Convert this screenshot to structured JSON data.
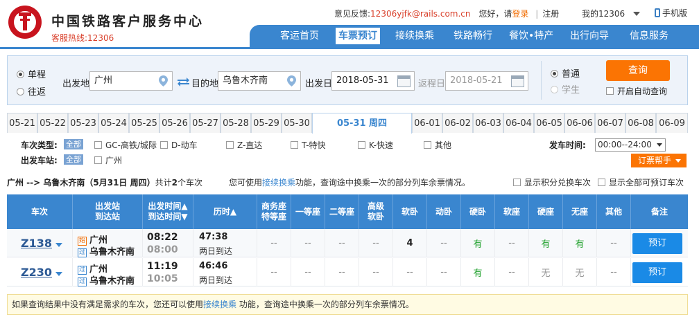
{
  "header": {
    "site_title": "中国铁路客户服务中心",
    "hotline": "客服热线:12306",
    "feedback_label": "意见反馈:",
    "feedback_email": "12306yjfk@rails.com.cn",
    "greeting": "您好，请",
    "login": "登录",
    "divider": "|",
    "register": "注册",
    "my_account": "我的12306",
    "mobile": "手机版"
  },
  "nav": {
    "items": [
      "客运首页",
      "车票预订",
      "接续换乘",
      "铁路畅行",
      "餐饮•特产",
      "出行向导",
      "信息服务"
    ],
    "active": "车票预订"
  },
  "search": {
    "trip_one_way": "单程",
    "trip_round": "往返",
    "from_label": "出发地",
    "from_value": "广州",
    "to_label": "目的地",
    "to_value": "乌鲁木齐南",
    "depart_label": "出发日",
    "depart_value": "2018-05-31",
    "return_label": "返程日",
    "return_value": "2018-05-21",
    "ticket_normal": "普通",
    "ticket_student": "学生",
    "query_button": "查询",
    "auto_query": "开启自动查询"
  },
  "dates": [
    "05-21",
    "05-22",
    "05-23",
    "05-24",
    "05-25",
    "05-26",
    "05-27",
    "05-28",
    "05-29",
    "05-30",
    "05-31 周四",
    "06-01",
    "06-02",
    "06-03",
    "06-04",
    "06-05",
    "06-06",
    "06-07",
    "06-08",
    "06-09"
  ],
  "active_date": "05-31 周四",
  "filters": {
    "type_label": "车次类型:",
    "all": "全部",
    "types": [
      "GC-高铁/城际",
      "D-动车",
      "Z-直达",
      "T-特快",
      "K-快速",
      "其他"
    ],
    "station_label": "出发车站:",
    "stations": [
      "广州"
    ],
    "time_label": "发车时间:",
    "time_value": "00:00--24:00",
    "help_button": "订票帮手"
  },
  "summary": {
    "route": "广州 --> 乌鲁木齐南",
    "date": "（5月31日  周四）",
    "count_prefix": "共计",
    "count": "2",
    "count_suffix": "个车次",
    "hint_prefix": "您可使用",
    "hint_link": "接续换乘",
    "hint_suffix": "功能，查询途中换乘一次的部分列车余票情况。",
    "opt_points": "显示积分兑换车次",
    "opt_all": "显示全部可预订车次"
  },
  "table": {
    "headers": [
      "车次",
      "出发站\n到达站",
      "出发时间▲\n到达时间▼",
      "历时▲",
      "商务座\n特等座",
      "一等座",
      "二等座",
      "高级\n软卧",
      "软卧",
      "动卧",
      "硬卧",
      "软座",
      "硬座",
      "无座",
      "其他",
      "备注"
    ],
    "rows": [
      {
        "train": "Z138",
        "from_badge": "始",
        "from": "广州",
        "to_badge": "过",
        "to": "乌鲁木齐南",
        "depart": "08:22",
        "arrive": "08:00",
        "duration": "47:38",
        "duration_note": "两日到达",
        "seats": [
          "--",
          "--",
          "--",
          "--",
          "4",
          "--",
          "有",
          "--",
          "有",
          "有",
          "--"
        ],
        "book": "预订"
      },
      {
        "train": "Z230",
        "from_badge": "过",
        "from": "广州",
        "to_badge": "过",
        "to": "乌鲁木齐南",
        "depart": "11:19",
        "arrive": "10:05",
        "duration": "46:46",
        "duration_note": "两日到达",
        "seats": [
          "--",
          "--",
          "--",
          "--",
          "--",
          "--",
          "有",
          "--",
          "无",
          "无",
          "--"
        ],
        "book": "预订"
      }
    ]
  },
  "notice": {
    "prefix": "如果查询结果中没有满足需求的车次，您还可以使用",
    "link": "接续换乘",
    "suffix": " 功能，查询途中换乘一次的部分列车余票情况。"
  },
  "colors": {
    "primary": "#3a86cf",
    "accent": "#fb7403",
    "book": "#1a8ae6",
    "available": "#20a12c"
  }
}
